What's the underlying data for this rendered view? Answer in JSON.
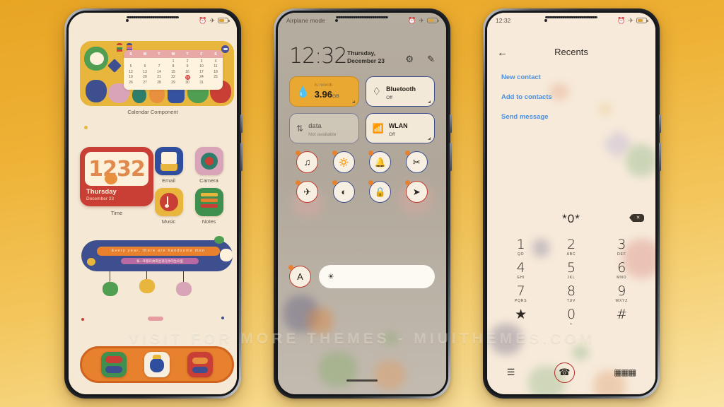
{
  "watermark": "VISIT FOR MORE THEMES - MIUITHEMES.COM",
  "phone_home": {
    "statusbar": {
      "alarm_icon": "alarm-icon",
      "airplane_icon": "airplane-icon",
      "battery_icon": "battery-icon"
    },
    "calendar_widget": {
      "label": "Calendar Component",
      "weekdays": [
        "S",
        "M",
        "T",
        "W",
        "T",
        "F",
        "S"
      ],
      "weeks": [
        [
          "",
          "",
          "",
          "1",
          "2",
          "3",
          "4"
        ],
        [
          "5",
          "6",
          "7",
          "8",
          "9",
          "10",
          "11"
        ],
        [
          "12",
          "13",
          "14",
          "15",
          "16",
          "17",
          "18"
        ],
        [
          "19",
          "20",
          "21",
          "22",
          "23",
          "24",
          "25"
        ],
        [
          "26",
          "27",
          "28",
          "29",
          "30",
          "31",
          ""
        ]
      ],
      "today": "23"
    },
    "time_widget": {
      "label": "Time",
      "hour": "12",
      "minute": "32",
      "day": "Thursday",
      "date": "December 23"
    },
    "apps": [
      {
        "name": "Email",
        "color": "#2f4f9e"
      },
      {
        "name": "Camera",
        "color": "#d9a3b8"
      },
      {
        "name": "Music",
        "color": "#e8b63c"
      },
      {
        "name": "Notes",
        "color": "#3f8f4e"
      }
    ],
    "quote_widget": {
      "line1": "Every year, there are handsome men",
      "line2": "每一年都有帅哥出现在你的生命里"
    },
    "dock": [
      {
        "name": "messages-app",
        "color": "#3f8f4e"
      },
      {
        "name": "gallery-app",
        "color": "#f7eee0"
      },
      {
        "name": "browser-app",
        "color": "#c93f35"
      }
    ]
  },
  "phone_control_center": {
    "statusbar": {
      "label": "Airplane mode"
    },
    "time": "12:32",
    "date": "Thursday, December 23",
    "settings_icon": "gear-icon",
    "edit_icon": "edit-icon",
    "tiles": [
      {
        "title": "",
        "sub": "is month",
        "value": "3.96",
        "unit": "GB",
        "icon": "water-drop-icon",
        "state": "on"
      },
      {
        "title": "Bluetooth",
        "sub": "Off",
        "icon": "bluetooth-icon",
        "state": "off"
      },
      {
        "title": "data",
        "sub": "Not available",
        "icon": "data-arrows-icon",
        "state": "disabled"
      },
      {
        "title": "WLAN",
        "sub": "Off",
        "icon": "wifi-icon",
        "state": "off"
      }
    ],
    "toggles": [
      {
        "name": "vibrate-icon",
        "glyph": "✇",
        "ring": "red"
      },
      {
        "name": "flashlight-icon",
        "glyph": "ὒ6",
        "ring": "blue"
      },
      {
        "name": "bell-icon",
        "glyph": "ὑ4",
        "ring": "blue"
      },
      {
        "name": "screenshot-icon",
        "glyph": "✂",
        "ring": "blue"
      },
      {
        "name": "airplane-icon",
        "glyph": "✈",
        "ring": "red"
      },
      {
        "name": "dark-mode-icon",
        "glyph": "◐",
        "ring": "blue"
      },
      {
        "name": "lock-icon",
        "glyph": "ὑ2",
        "ring": "blue"
      },
      {
        "name": "location-icon",
        "glyph": "➤",
        "ring": "red"
      }
    ],
    "auto_brightness": "A",
    "brightness_icon": "sun-icon"
  },
  "phone_dialer": {
    "statusbar": {
      "time": "12:32"
    },
    "back_icon": "back-arrow-icon",
    "title": "Recents",
    "links": [
      "New contact",
      "Add to contacts",
      "Send message"
    ],
    "dialed_number": "*0*",
    "delete_icon": "backspace-icon",
    "keys": [
      {
        "n": "1",
        "s": "QO"
      },
      {
        "n": "2",
        "s": "ABC"
      },
      {
        "n": "3",
        "s": "DEF"
      },
      {
        "n": "4",
        "s": "GHI"
      },
      {
        "n": "5",
        "s": "JKL"
      },
      {
        "n": "6",
        "s": "MNO"
      },
      {
        "n": "7",
        "s": "PQRS"
      },
      {
        "n": "8",
        "s": "TUV"
      },
      {
        "n": "9",
        "s": "WXYZ"
      },
      {
        "n": "★",
        "s": ""
      },
      {
        "n": "0",
        "s": "+"
      },
      {
        "n": "#",
        "s": ""
      }
    ],
    "menu_icon": "hamburger-menu-icon",
    "call_icon": "phone-call-icon",
    "keypad_icon": "keypad-grid-icon"
  }
}
